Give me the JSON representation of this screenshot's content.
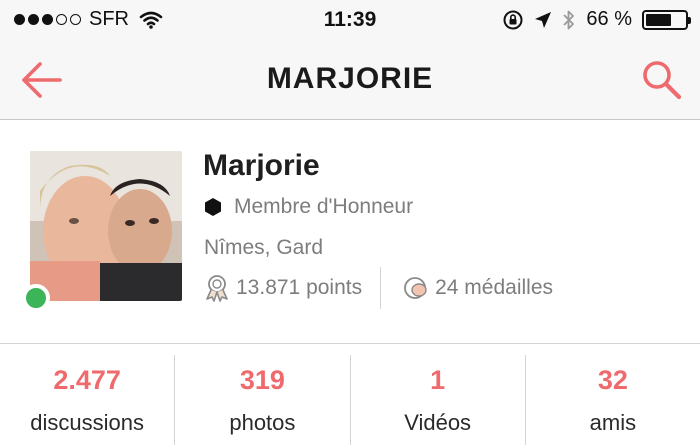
{
  "status_bar": {
    "carrier": "SFR",
    "time": "11:39",
    "battery": "66 %",
    "battery_level": 0.66
  },
  "nav": {
    "title": "MARJORIE",
    "back_icon": "arrow-left-icon",
    "search_icon": "search-icon",
    "accent_color": "#ee6a6d"
  },
  "profile": {
    "name": "Marjorie",
    "rank": "Membre d'Honneur",
    "location": "Nîmes, Gard",
    "points": "13.871 points",
    "medals": "24 médailles",
    "online": true,
    "online_color": "#3cb55a"
  },
  "counters": [
    {
      "value": "2.477",
      "label": "discussions"
    },
    {
      "value": "319",
      "label": "photos"
    },
    {
      "value": "1",
      "label": "Vidéos"
    },
    {
      "value": "32",
      "label": "amis"
    }
  ]
}
